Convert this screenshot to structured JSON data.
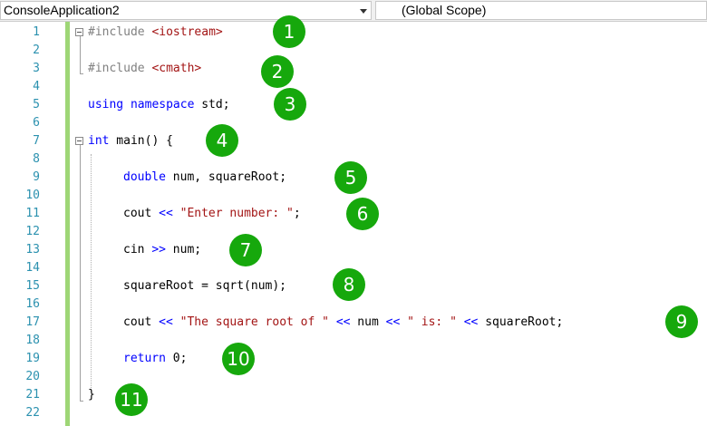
{
  "toolbar": {
    "project": "ConsoleApplication2",
    "scope": "(Global Scope)"
  },
  "line_numbers": [
    "1",
    "2",
    "3",
    "4",
    "5",
    "6",
    "7",
    "8",
    "9",
    "10",
    "11",
    "12",
    "13",
    "14",
    "15",
    "16",
    "17",
    "18",
    "19",
    "20",
    "21",
    "22"
  ],
  "code": {
    "l1_directive": "#include",
    "l1_header": "<iostream>",
    "l3_directive": "#include",
    "l3_header": "<cmath>",
    "l5_kw": "using namespace",
    "l5_rest": " std;",
    "l7_kw": "int",
    "l7_rest": " main() {",
    "l9_kw": "double",
    "l9_rest": " num, squareRoot;",
    "l11_a": "cout ",
    "l11_op": "<<",
    "l11_str": "\"Enter number: \"",
    "l11_end": ";",
    "l13_a": "cin ",
    "l13_op": ">>",
    "l13_end": " num;",
    "l15": "squareRoot = sqrt(num);",
    "l17_a": "cout ",
    "l17_op1": "<<",
    "l17_str1": "\"The square root of \"",
    "l17_op2": "<<",
    "l17_b": " num ",
    "l17_op3": "<<",
    "l17_str2": "\" is: \"",
    "l17_op4": "<<",
    "l17_end": " squareRoot;",
    "l19_kw": "return",
    "l19_end": " 0;",
    "l21": "}"
  },
  "badges": [
    "1",
    "2",
    "3",
    "4",
    "5",
    "6",
    "7",
    "8",
    "9",
    "10",
    "11"
  ],
  "colors": {
    "line_number": "#2b91af",
    "keyword": "#0000ff",
    "string": "#a31515",
    "preprocessor": "#808080",
    "change_bar": "#9ed676",
    "badge": "#16a80c"
  }
}
